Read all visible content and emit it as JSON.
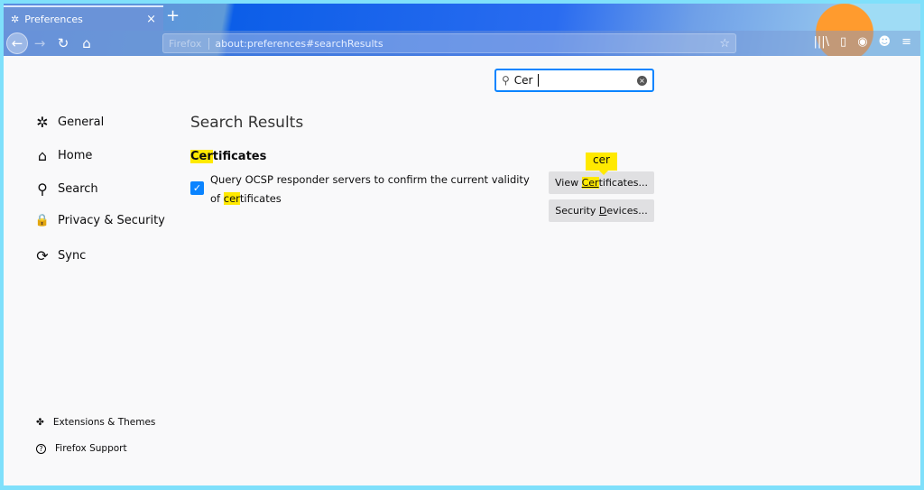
{
  "tab": {
    "title": "Preferences",
    "icon": "gear-icon",
    "close": "×",
    "new_tab": "+"
  },
  "toolbar": {
    "back": "←",
    "forward": "→",
    "reload": "↻",
    "home": "⌂",
    "identity": "Firefox",
    "url": "about:preferences#searchResults",
    "bookmark": "☆"
  },
  "search": {
    "value": "Cer",
    "clear": "×"
  },
  "sidebar": {
    "items": [
      {
        "label": "General",
        "icon": "gear-icon",
        "glyph": "✲"
      },
      {
        "label": "Home",
        "icon": "home-icon",
        "glyph": "⌂"
      },
      {
        "label": "Search",
        "icon": "search-icon",
        "glyph": "⚲"
      },
      {
        "label": "Privacy & Security",
        "icon": "lock-icon",
        "glyph": "🔒"
      },
      {
        "label": "Sync",
        "icon": "sync-icon",
        "glyph": "⟳"
      }
    ],
    "footer": [
      {
        "label": "Extensions & Themes",
        "icon": "puzzle-icon",
        "glyph": "✤"
      },
      {
        "label": "Firefox Support",
        "icon": "help-icon",
        "glyph": "?"
      }
    ]
  },
  "main": {
    "title": "Search Results",
    "section": {
      "title_hl": "Cer",
      "title_rest": "tificates",
      "checkbox": {
        "checked": true,
        "label_a": "Query OCSP responder servers to confirm the current validity of ",
        "label_hl": "cer",
        "label_b": "tificates"
      },
      "view_btn": {
        "a": "View ",
        "hl": "Cer",
        "b": "tificates..."
      },
      "devices_btn": {
        "a": "Security ",
        "u": "D",
        "b": "evices..."
      },
      "tooltip": "cer"
    }
  },
  "colors": {
    "accent": "#0a84ff",
    "highlight": "#ffe900"
  }
}
